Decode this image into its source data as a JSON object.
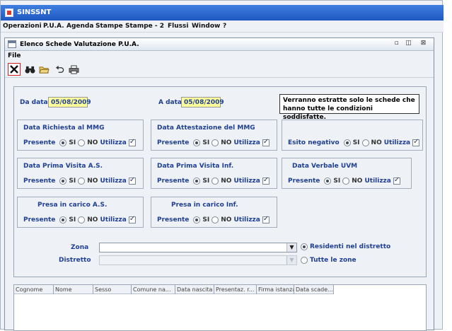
{
  "app": {
    "title": "SINSSNT"
  },
  "menubar": {
    "items": [
      "Operazioni",
      "P.U.A.",
      "Agenda",
      "Stampe",
      "Stampe - 2",
      "Flussi",
      "Window",
      "?"
    ]
  },
  "window": {
    "title": "Elenco Schede Valutazione P.U.A.",
    "menu_file": "File",
    "controls": {
      "restore": "▫",
      "maximize": "◫",
      "close": "⊠"
    }
  },
  "toolbar": {
    "icons": [
      "close-icon",
      "binoculars-icon",
      "open-folder-icon",
      "undo-icon",
      "printer-icon"
    ]
  },
  "filters": {
    "da_data_label": "Da data",
    "da_data_value": "05/08/2009",
    "a_data_label": "A data",
    "a_data_value": "05/08/2009",
    "info_text": "Verranno estratte solo le schede che hanno tutte le condizioni soddisfatte.",
    "groups": [
      {
        "title": "Data Richiesta al MMG",
        "presente": "Presente",
        "si": "SI",
        "no": "NO",
        "utilizza": "Utilizza",
        "selected": "SI",
        "checked": true
      },
      {
        "title": "Data Attestazione del MMG",
        "presente": "Presente",
        "si": "SI",
        "no": "NO",
        "utilizza": "Utilizza",
        "selected": "SI",
        "checked": true
      },
      {
        "title": "Esito negativo",
        "si": "SI",
        "no": "NO",
        "utilizza": "Utilizza",
        "selected": "SI",
        "checked": true
      },
      {
        "title": "Data Prima Visita A.S.",
        "presente": "Presente",
        "si": "SI",
        "no": "NO",
        "utilizza": "Utilizza",
        "selected": "SI",
        "checked": true
      },
      {
        "title": "Data Prima Visita Inf.",
        "presente": "Presente",
        "si": "SI",
        "no": "NO",
        "utilizza": "Utilizza",
        "selected": "SI",
        "checked": true
      },
      {
        "title": "Data Verbale UVM",
        "presente": "Presente",
        "si": "SI",
        "no": "NO",
        "utilizza": "Utilizza",
        "selected": "SI",
        "checked": true
      },
      {
        "title": "Presa in carico A.S.",
        "presente": "Presente",
        "si": "SI",
        "no": "NO",
        "utilizza": "Utilizza",
        "selected": "SI",
        "checked": true
      },
      {
        "title": "Presa in carico Inf.",
        "presente": "Presente",
        "si": "SI",
        "no": "NO",
        "utilizza": "Utilizza",
        "selected": "SI",
        "checked": true
      }
    ],
    "zona_label": "Zona",
    "distretto_label": "Distretto",
    "residenti_label": "Residenti nel distretto",
    "tutte_label": "Tutte le zone",
    "location_selected": "Residenti nel distretto"
  },
  "table": {
    "columns": [
      "Cognome",
      "Nome",
      "Sesso",
      "Comune na...",
      "Data nascita",
      "Presentaz. r...",
      "Firma istanza",
      "Data scade..."
    ]
  },
  "colors": {
    "accent": "#1f3f93",
    "date_bg": "#ffff99",
    "titlebar": "#2a67d0",
    "close_border": "#d01f1f"
  }
}
